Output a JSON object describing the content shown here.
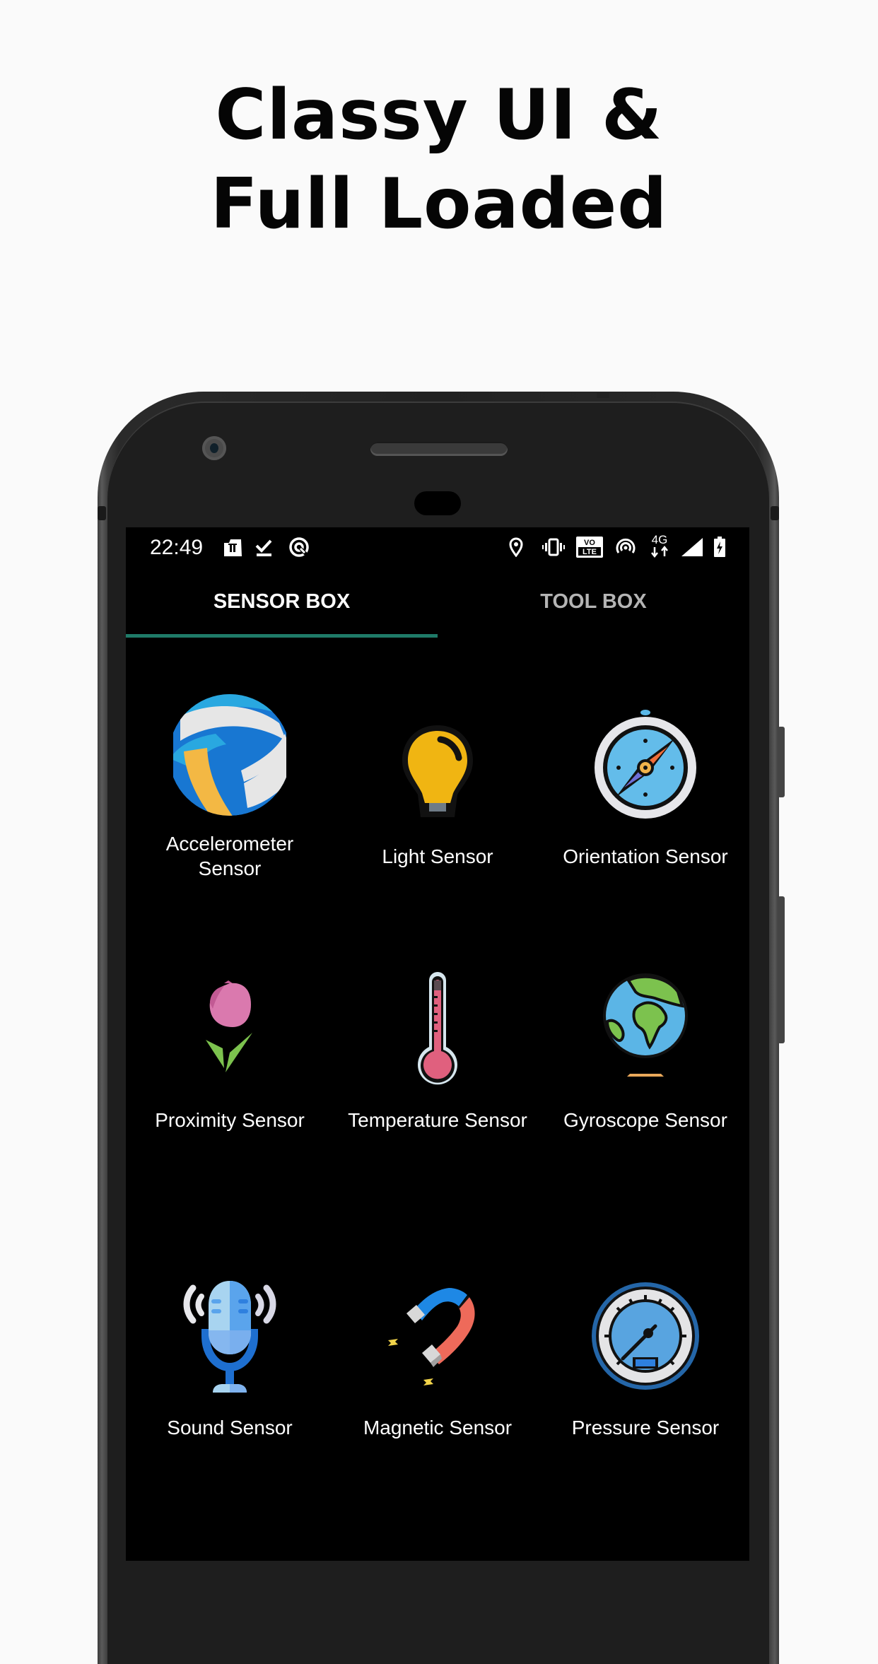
{
  "headline": {
    "line1": "Classy UI &",
    "line2": "Full Loaded"
  },
  "status_bar": {
    "time": "22:49",
    "left_icons": [
      "notification-app-icon",
      "download-done-icon",
      "sync-icon"
    ],
    "right_icons": [
      "location-icon",
      "vibrate-icon",
      "volte-icon",
      "hotspot-icon",
      "4g-data-icon",
      "signal-icon",
      "battery-charging-icon"
    ],
    "volte_top": "VO",
    "volte_bottom": "LTE",
    "network": "4G"
  },
  "tabs": [
    {
      "label": "SENSOR BOX",
      "active": true
    },
    {
      "label": "TOOL BOX",
      "active": false
    }
  ],
  "colors": {
    "accent": "#1F7A68",
    "background": "#000000",
    "page_background": "#FAFAFA"
  },
  "sensors": [
    {
      "label": "Accelerometer Sensor",
      "icon": "volleyball-icon"
    },
    {
      "label": "Light Sensor",
      "icon": "light-bulb-icon"
    },
    {
      "label": "Orientation Sensor",
      "icon": "compass-icon"
    },
    {
      "label": "Proximity Sensor",
      "icon": "tulip-icon"
    },
    {
      "label": "Temperature Sensor",
      "icon": "thermometer-icon"
    },
    {
      "label": "Gyroscope Sensor",
      "icon": "globe-icon"
    },
    {
      "label": "Sound Sensor",
      "icon": "microphone-icon"
    },
    {
      "label": "Magnetic Sensor",
      "icon": "magnet-icon"
    },
    {
      "label": "Pressure Sensor",
      "icon": "gauge-icon"
    }
  ]
}
